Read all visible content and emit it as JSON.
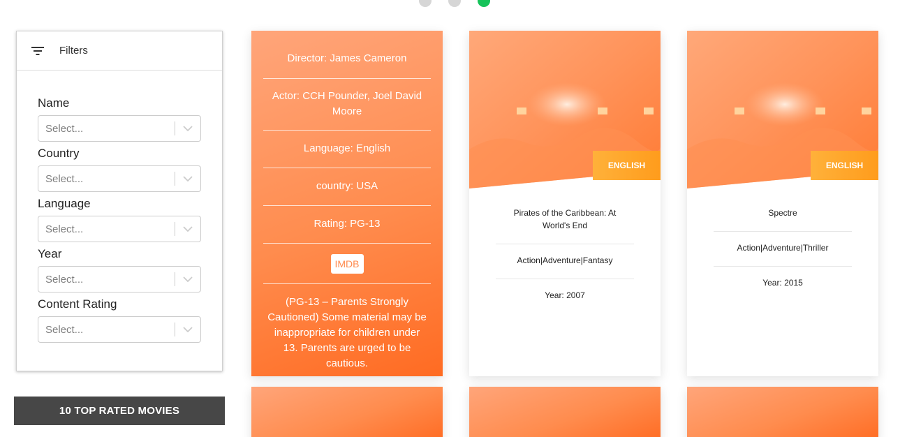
{
  "pager": {
    "dots": 3,
    "active": 3
  },
  "filters": {
    "title": "Filters",
    "icon": "filter-icon",
    "groups": [
      {
        "label": "Name",
        "placeholder": "Select..."
      },
      {
        "label": "Country",
        "placeholder": "Select..."
      },
      {
        "label": "Language",
        "placeholder": "Select..."
      },
      {
        "label": "Year",
        "placeholder": "Select..."
      },
      {
        "label": "Content Rating",
        "placeholder": "Select..."
      }
    ]
  },
  "top_rated": {
    "title": "10 TOP RATED MOVIES"
  },
  "movie_back": {
    "director": "Director: James Cameron",
    "actor": "Actor: CCH Pounder, Joel David Moore",
    "language": "Language: English",
    "country": "country: USA",
    "rating": "Rating: PG-13",
    "imdb_label": "IMDB",
    "rating_description": "(PG-13 – Parents Strongly Cautioned) Some material may be inappropriate for children under 13. Parents are urged to be cautious."
  },
  "movies": [
    {
      "language_badge": "ENGLISH",
      "title": "Pirates of the Caribbean: At World's End",
      "genres": "Action|Adventure|Fantasy",
      "year": "Year: 2007"
    },
    {
      "language_badge": "ENGLISH",
      "title": "Spectre",
      "genres": "Action|Adventure|Thriller",
      "year": "Year: 2015"
    }
  ],
  "colors": {
    "accent": "#ff8a4e",
    "active_dot": "#16c35a",
    "header_dark": "#474747",
    "badge": "#ffa82e"
  }
}
